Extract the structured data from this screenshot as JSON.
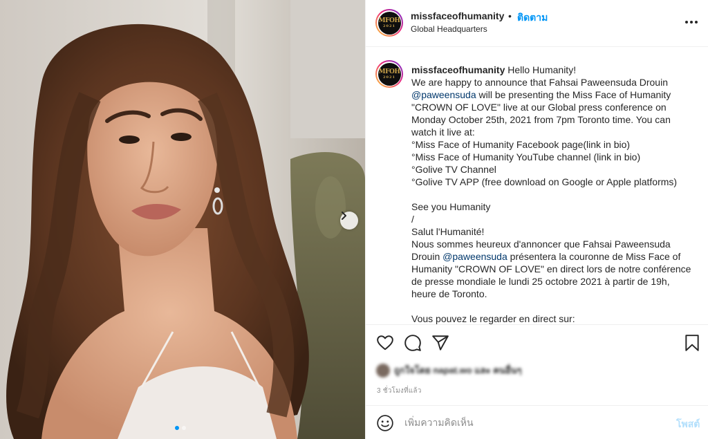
{
  "post": {
    "username": "missfaceofhumanity",
    "separator": "•",
    "follow_label": "ติดตาม",
    "location": "Global Headquarters",
    "avatar_logo": {
      "line1": "MFOH",
      "line2": "2021"
    },
    "image_alt": "Portrait of a woman with long wavy brown hair",
    "carousel": {
      "dots": 2,
      "active_index": 0
    }
  },
  "caption": {
    "username": "missfaceofhumanity",
    "part1": " Hello Humanity!\nWe are happy to announce that Fahsai Paweensuda Drouin\n",
    "mention1": "@paweensuda",
    "part2": " will be presenting the Miss Face of Humanity \"CROWN OF LOVE\" live at our Global press conference on Monday October 25th, 2021 from 7pm Toronto time. You can watch it live at:\n°Miss Face of Humanity Facebook page(link in bio)\n°Miss Face of Humanity YouTube channel (link in bio)\n°Golive TV Channel\n°Golive TV APP (free download on Google or Apple platforms)\n\nSee you Humanity\n/\nSalut l'Humanité!\nNous sommes heureux d'annoncer que Fahsai Paweensuda Drouin ",
    "mention2": "@paweensuda",
    "part3": " présentera la couronne de Miss Face of Humanity \"CROWN OF LOVE\" en direct lors de notre conférence de presse mondiale le lundi 25 octobre 2021 à partir de 19h, heure de Toronto.\n\nVous pouvez le regarder en direct sur:"
  },
  "actions": {
    "icons": [
      "heart-icon",
      "comment-icon",
      "share-icon",
      "bookmark-icon"
    ],
    "likes_text": "ถูกใจโดย napat.wo และ คนอื่นๆ",
    "timestamp": "3 ชั่วโมงที่แล้ว"
  },
  "comment": {
    "placeholder": "เพิ่มความคิดเห็น",
    "post_label": "โพสต์"
  },
  "colors": {
    "accent": "#0095f6",
    "post_disabled": "#b2dffc",
    "text": "#262626",
    "muted": "#8e8e8e",
    "mention": "#00376b"
  }
}
